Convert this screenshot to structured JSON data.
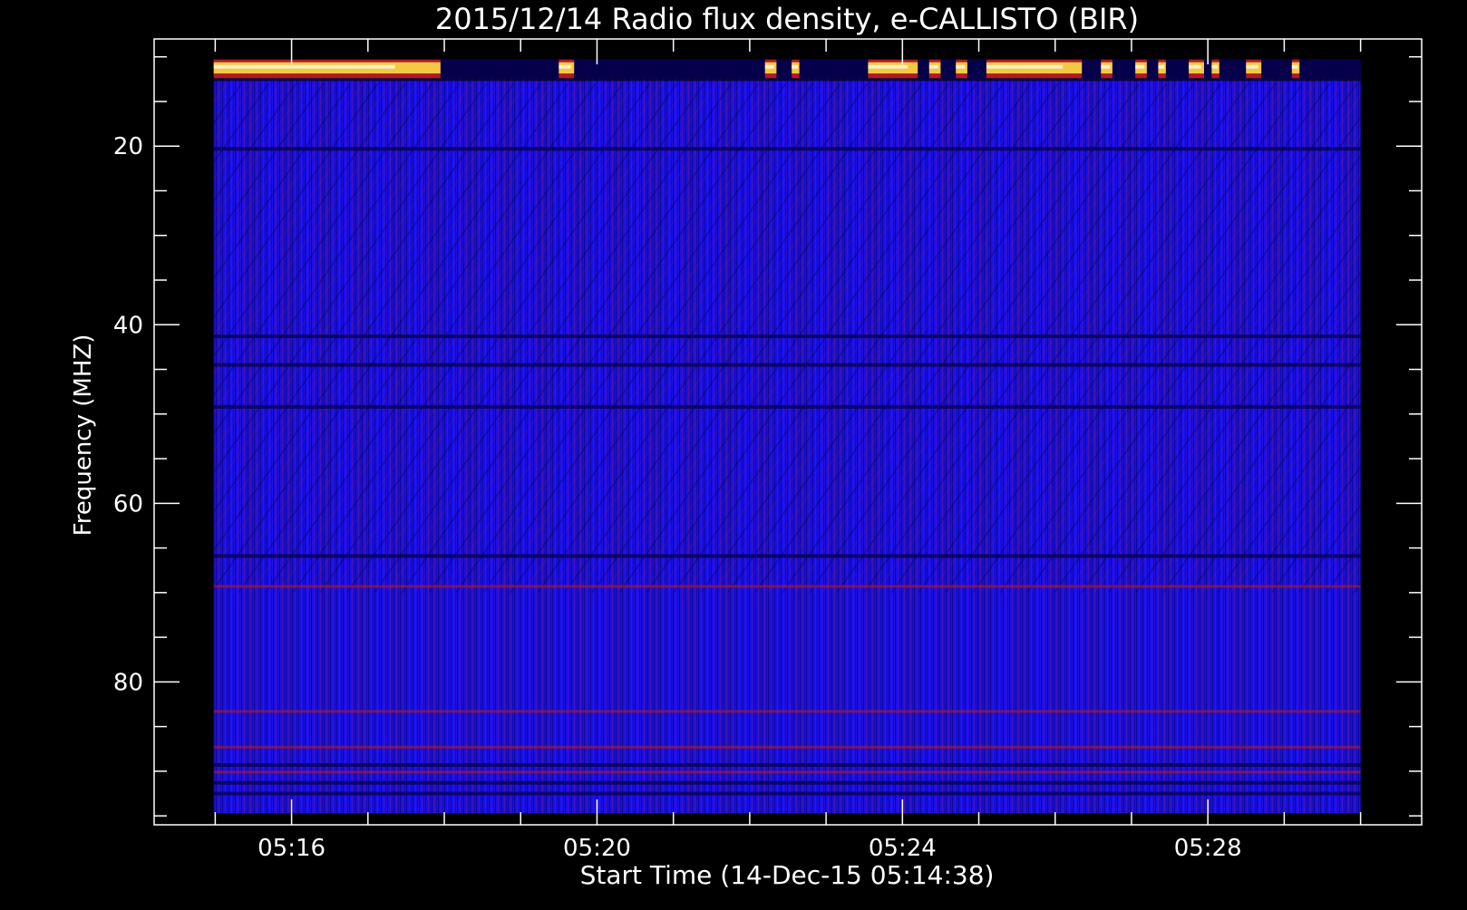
{
  "chart_data": {
    "type": "heatmap",
    "title": "2015/12/14  Radio flux density, e-CALLISTO (BIR)",
    "xlabel": "Start Time (14-Dec-15 05:14:38)",
    "ylabel": "Frequency (MHZ)",
    "x_ticks": [
      "05:16",
      "05:20",
      "05:24",
      "05:28"
    ],
    "x_tick_minutes": [
      16,
      20,
      24,
      28
    ],
    "x_minor_step_minutes": 1,
    "xlim_minutes": [
      14.2,
      30.8
    ],
    "data_x_range_minutes": [
      14.98,
      30.0
    ],
    "y_ticks": [
      20,
      40,
      60,
      80
    ],
    "y_minor_step": 5,
    "ylim": [
      96,
      8
    ],
    "data_y_range": [
      10.3,
      94.7
    ],
    "colors": {
      "background": "#1a10e8",
      "dark": "#05004a",
      "red": "#b01a20",
      "yellow": "#ffe84a",
      "white": "#ffffff",
      "axis": "#ffffff"
    },
    "hot_band_mhz": [
      10.3,
      12.4
    ],
    "hot_spans_minutes": [
      [
        14.98,
        17.95
      ],
      [
        19.5,
        19.7
      ],
      [
        22.2,
        22.35
      ],
      [
        22.55,
        22.65
      ],
      [
        23.55,
        24.2
      ],
      [
        24.35,
        24.5
      ],
      [
        24.7,
        24.85
      ],
      [
        25.1,
        26.35
      ],
      [
        26.6,
        26.75
      ],
      [
        27.05,
        27.2
      ],
      [
        27.35,
        27.45
      ],
      [
        27.75,
        27.95
      ],
      [
        28.05,
        28.15
      ],
      [
        28.5,
        28.7
      ],
      [
        29.1,
        29.2
      ]
    ],
    "dark_lines_mhz": [
      20.3,
      41.3,
      44.5,
      49.2,
      65.9,
      89.3,
      91.3,
      92.5
    ],
    "red_lines_mhz": [
      69.3,
      83.3,
      87.3,
      90.1
    ]
  }
}
